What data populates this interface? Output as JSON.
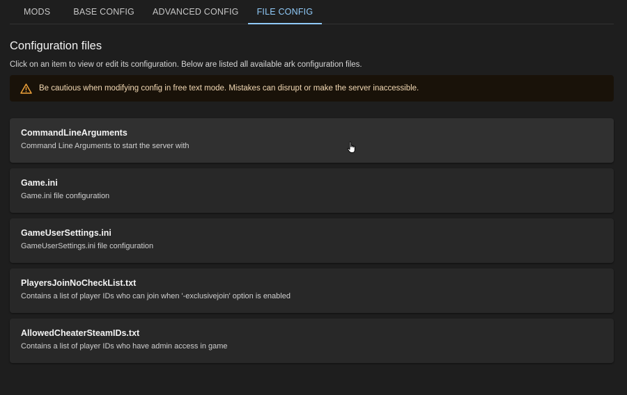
{
  "tabs": [
    {
      "label": "MODS"
    },
    {
      "label": "BASE CONFIG"
    },
    {
      "label": "ADVANCED CONFIG"
    },
    {
      "label": "FILE CONFIG"
    }
  ],
  "active_tab": "FILE CONFIG",
  "page": {
    "title": "Configuration files",
    "subtitle": "Click on an item to view or edit its configuration. Below are listed all available ark configuration files."
  },
  "alert": {
    "icon": "warning-icon",
    "text": "Be cautious when modifying config in free text mode. Mistakes can disrupt or make the server inaccessible."
  },
  "files": [
    {
      "name": "CommandLineArguments",
      "description": "Command Line Arguments to start the server with"
    },
    {
      "name": "Game.ini",
      "description": "Game.ini file configuration"
    },
    {
      "name": "GameUserSettings.ini",
      "description": "GameUserSettings.ini file configuration"
    },
    {
      "name": "PlayersJoinNoCheckList.txt",
      "description": "Contains a list of player IDs who can join when '-exclusivejoin' option is enabled"
    },
    {
      "name": "AllowedCheaterSteamIDs.txt",
      "description": "Contains a list of player IDs who have admin access in game"
    }
  ],
  "colors": {
    "background": "#1e1e1e",
    "accent": "#90caf9",
    "warning": "#f0a33a",
    "alert_bg": "#191209"
  }
}
